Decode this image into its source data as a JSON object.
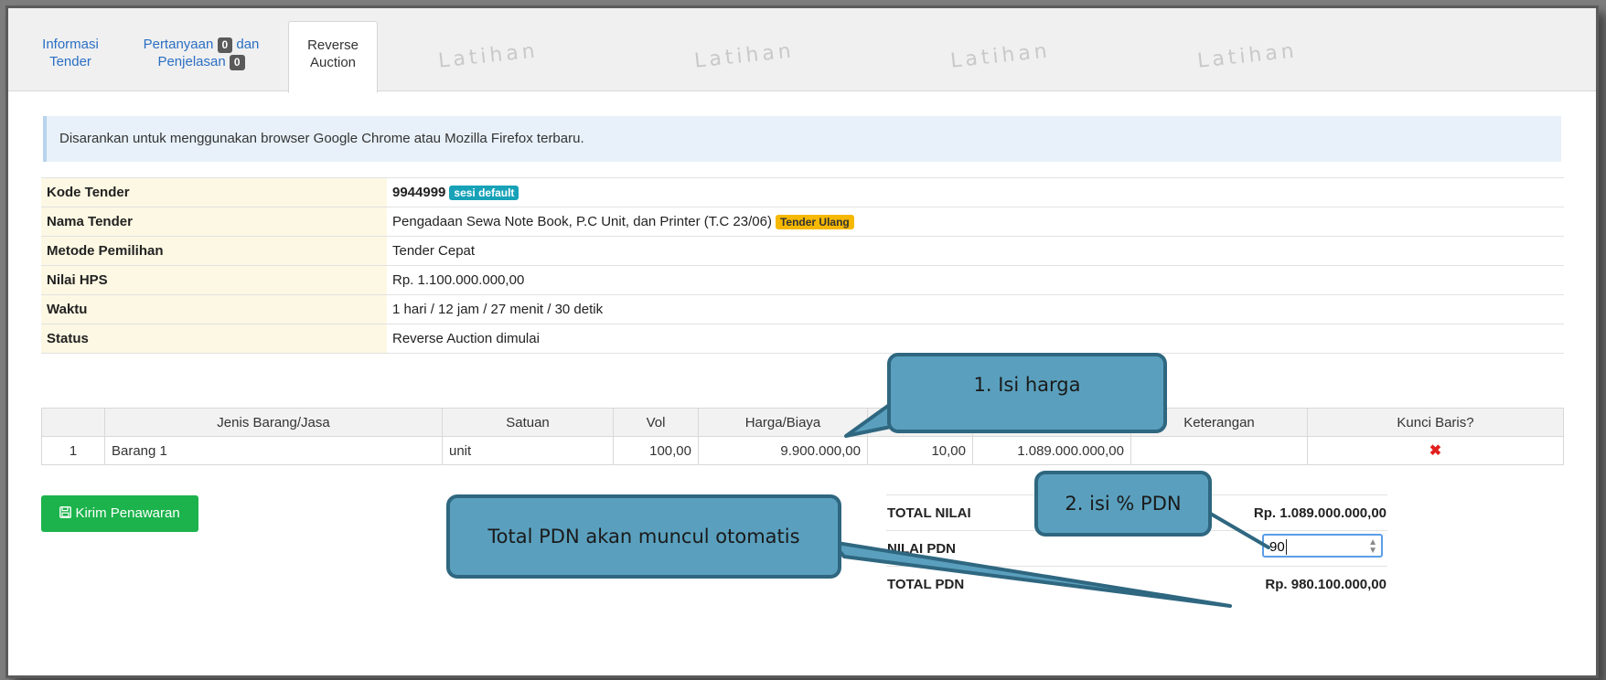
{
  "tabs": [
    {
      "line1": "Informasi",
      "line2": "Tender"
    },
    {
      "line1a": "Pertanyaan",
      "badge1": "0",
      "line1b": "dan",
      "line2": "Penjelasan",
      "badge2": "0"
    },
    {
      "line1": "Reverse",
      "line2": "Auction"
    }
  ],
  "watermark": "Latihan",
  "alert": "Disarankan untuk menggunakan browser Google Chrome atau Mozilla Firefox terbaru.",
  "info": {
    "kode_label": "Kode Tender",
    "kode_value": "9944999",
    "kode_badge": "sesi default",
    "nama_label": "Nama Tender",
    "nama_value": "Pengadaan Sewa Note Book, P.C Unit, dan Printer (T.C 23/06)",
    "nama_badge": "Tender Ulang",
    "metode_label": "Metode Pemilihan",
    "metode_value": "Tender Cepat",
    "hps_label": "Nilai HPS",
    "hps_value": "Rp. 1.100.000.000,00",
    "waktu_label": "Waktu",
    "waktu_value": "1 hari / 12 jam / 27 menit / 30 detik",
    "status_label": "Status",
    "status_value": "Reverse Auction dimulai"
  },
  "items_table": {
    "headers": [
      "",
      "Jenis Barang/Jasa",
      "Satuan",
      "Vol",
      "Harga/Biaya",
      "",
      "",
      "Keterangan",
      "Kunci Baris?"
    ],
    "rows": [
      {
        "no": "1",
        "jenis": "Barang 1",
        "satuan": "unit",
        "vol": "100,00",
        "harga": "9.900.000,00",
        "pajak": "10,00",
        "total": "1.089.000.000,00",
        "keterangan": "",
        "kunci": "✖"
      }
    ]
  },
  "submit_button": "Kirim Penawaran",
  "totals": {
    "total_nilai_label": "TOTAL NILAI",
    "total_nilai_value": "Rp. 1.089.000.000,00",
    "nilai_pdn_label": "NILAI PDN",
    "nilai_pdn_value": "90",
    "total_pdn_label": "TOTAL PDN",
    "total_pdn_value": "Rp. 980.100.000,00"
  },
  "callouts": {
    "isi_harga": "1. Isi harga",
    "isi_pdn": "2. isi % PDN",
    "total_pdn": "Total PDN akan muncul otomatis"
  },
  "colors": {
    "callout_fill": "#5aa0be",
    "callout_border": "#2f6780",
    "button_green": "#1cb34c",
    "badge_info": "#17a2b8",
    "badge_warning": "#f6b800",
    "key_cell_bg": "#fcf8e3"
  }
}
